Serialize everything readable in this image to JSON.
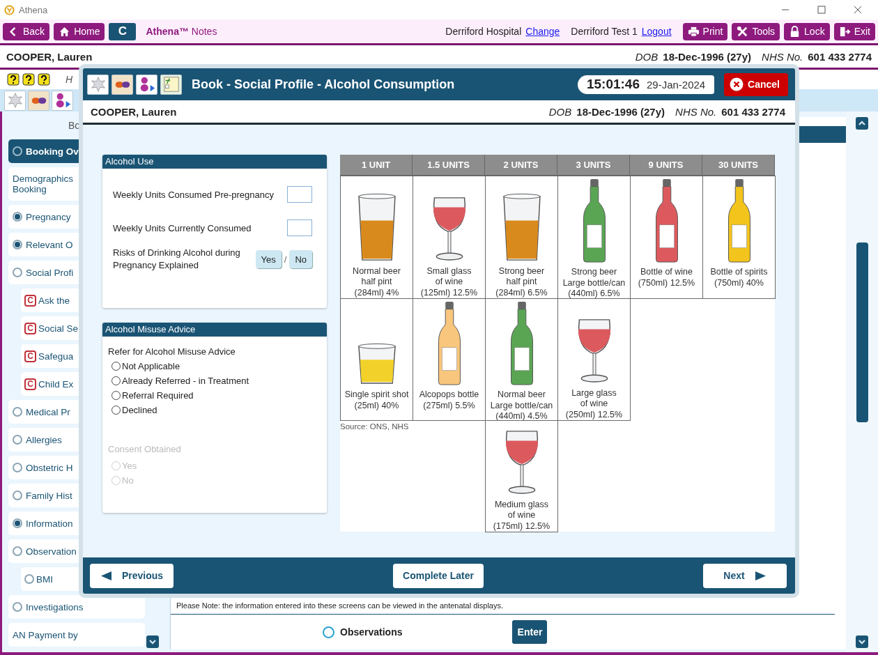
{
  "window": {
    "title": "Athena"
  },
  "nav": {
    "buttons": [
      {
        "label": "Back"
      },
      {
        "label": "Home"
      }
    ],
    "shortcut": "C",
    "brand": "**Athena™** Notes",
    "site": "Derriford Hospital",
    "site_link": "Change",
    "user": "Derriford Test 1",
    "user_link": "Logout",
    "actions": [
      {
        "label": "Print"
      },
      {
        "label": "Tools"
      },
      {
        "label": "Lock"
      },
      {
        "label": "Exit"
      }
    ]
  },
  "patient": {
    "name": "COOPER, Lauren",
    "dob_label": "DOB",
    "dob": "18-Dec-1996 (27y)",
    "nhs_label": "NHS No.",
    "nhs": "601 433 2774"
  },
  "hint": "H",
  "sidebar": {
    "heading": "Bo",
    "items": [
      {
        "label": "Booking Ov",
        "kind": "radio",
        "checked": false,
        "selected": true
      },
      {
        "lines": [
          "Demographics",
          "Booking"
        ],
        "kind": "plain",
        "selected": false
      },
      {
        "label": "Pregnancy",
        "kind": "radio",
        "checked": true,
        "selected": false
      },
      {
        "label": "Relevant O",
        "kind": "radio",
        "checked": true,
        "selected": false
      },
      {
        "label": "Social Profi",
        "kind": "radio",
        "checked": false,
        "selected": false,
        "children": [
          {
            "label": "Ask the",
            "kind": "badge",
            "badge": "C",
            "selected": false
          },
          {
            "label": "Social Se",
            "kind": "badge",
            "badge": "C",
            "selected": false
          },
          {
            "label": "Safegua",
            "kind": "badge",
            "badge": "C",
            "selected": false
          },
          {
            "label": "Child Ex",
            "kind": "badge",
            "badge": "C",
            "selected": false
          }
        ]
      },
      {
        "label": "Medical Pr",
        "kind": "radio",
        "checked": false,
        "selected": false
      },
      {
        "label": "Allergies",
        "kind": "radio",
        "checked": false,
        "selected": false
      },
      {
        "label": "Obstetric H",
        "kind": "radio",
        "checked": false,
        "selected": false
      },
      {
        "label": "Family Hist",
        "kind": "radio",
        "checked": false,
        "selected": false
      },
      {
        "label": "Information",
        "kind": "radio",
        "checked": true,
        "selected": false
      },
      {
        "label": "Observation",
        "kind": "radio",
        "checked": false,
        "selected": false,
        "children": [
          {
            "label": "BMI",
            "kind": "radio",
            "checked": false,
            "selected": false
          }
        ]
      },
      {
        "label": "Investigations",
        "kind": "radio",
        "checked": false,
        "selected": false
      },
      {
        "label": "AN Payment by",
        "kind": "plain",
        "selected": false
      }
    ]
  },
  "page_footer": {
    "note": "Please Note: the information entered into these screens can be viewed in the antenatal displays.",
    "option": {
      "label": "Observations",
      "checked": false
    },
    "button": "Enter"
  },
  "dialog": {
    "title": "Book - Social Profile - Alcohol Consumption",
    "time": "15:01:46",
    "date": "29-Jan-2024",
    "cancel": "Cancel",
    "patient": {
      "name": "COOPER, Lauren",
      "dob_label": "DOB",
      "dob": "18-Dec-1996 (27y)",
      "nhs_label": "NHS No.",
      "nhs": "601 433 2774"
    },
    "alcohol_use": {
      "title": "Alcohol Use",
      "fields": [
        {
          "label": "Weekly Units Consumed Pre-pregnancy"
        },
        {
          "label": "Weekly Units Currently Consumed"
        }
      ],
      "risks": {
        "label": "Risks of Drinking Alcohol during Pregnancy Explained",
        "options": [
          {
            "label": "Yes",
            "selected": false
          },
          {
            "label": "No",
            "selected": false
          }
        ],
        "separator": "/"
      }
    },
    "misuse": {
      "title": "Alcohol Misuse Advice",
      "question": "Refer for Alcohol Misuse Advice",
      "options": [
        {
          "label": "Not Applicable",
          "checked": false
        },
        {
          "label": "Already Referred - in Treatment",
          "checked": false
        },
        {
          "label": "Referral Required",
          "checked": false
        },
        {
          "label": "Declined",
          "checked": false
        }
      ],
      "consent": {
        "label": "Consent Obtained",
        "disabled": true,
        "options": [
          {
            "label": "Yes",
            "checked": false
          },
          {
            "label": "No",
            "checked": false
          }
        ]
      }
    },
    "units_chart": {
      "source": "Source: ONS, NHS",
      "columns": [
        {
          "heading": "1 UNIT",
          "drinks": [
            {
              "kind": "pint_glass",
              "color": "#d98a1c",
              "lines": [
                "Normal beer",
                "half pint",
                "(284ml) 4%"
              ]
            },
            {
              "kind": "shot_glass",
              "color": "#f2d22a",
              "lines": [
                "Single spirit shot",
                "(25ml) 40%"
              ]
            }
          ]
        },
        {
          "heading": "1.5 UNITS",
          "drinks": [
            {
              "kind": "wine_glass",
              "color": "#dc5a5e",
              "lines": [
                "Small glass",
                "of wine",
                "(125ml) 12.5%"
              ]
            },
            {
              "kind": "bottle",
              "color": "#f8c67c",
              "lines": [
                "Alcopops bottle",
                "(275ml) 5.5%"
              ]
            }
          ]
        },
        {
          "heading": "2 UNITS",
          "drinks": [
            {
              "kind": "pint_glass",
              "color": "#d98a1c",
              "lines": [
                "Strong beer",
                "half pint",
                "(284ml) 6.5%"
              ]
            },
            {
              "kind": "bottle",
              "color": "#5aa554",
              "lines": [
                "Normal beer",
                "Large bottle/can",
                "(440ml) 4.5%"
              ]
            },
            {
              "kind": "wine_glass",
              "color": "#dc5a5e",
              "lines": [
                "Medium glass",
                "of wine",
                "(175ml) 12.5%"
              ]
            }
          ]
        },
        {
          "heading": "3 UNITS",
          "drinks": [
            {
              "kind": "bottle",
              "color": "#5aa554",
              "lines": [
                "Strong beer",
                "Large bottle/can",
                "(440ml) 6.5%"
              ]
            },
            {
              "kind": "wine_glass",
              "color": "#dc5a5e",
              "lines": [
                "Large glass",
                "of wine",
                "(250ml) 12.5%"
              ]
            }
          ]
        },
        {
          "heading": "9 UNITS",
          "drinks": [
            {
              "kind": "bottle",
              "color": "#dc5a5e",
              "lines": [
                "Bottle of wine",
                "(750ml) 12.5%"
              ]
            }
          ]
        },
        {
          "heading": "30 UNITS",
          "drinks": [
            {
              "kind": "bottle",
              "color": "#f2c41c",
              "lines": [
                "Bottle of spirits",
                "(750ml) 40%"
              ]
            }
          ]
        }
      ]
    },
    "buttons": {
      "previous": "Previous",
      "later": "Complete Later",
      "next": "Next"
    }
  }
}
